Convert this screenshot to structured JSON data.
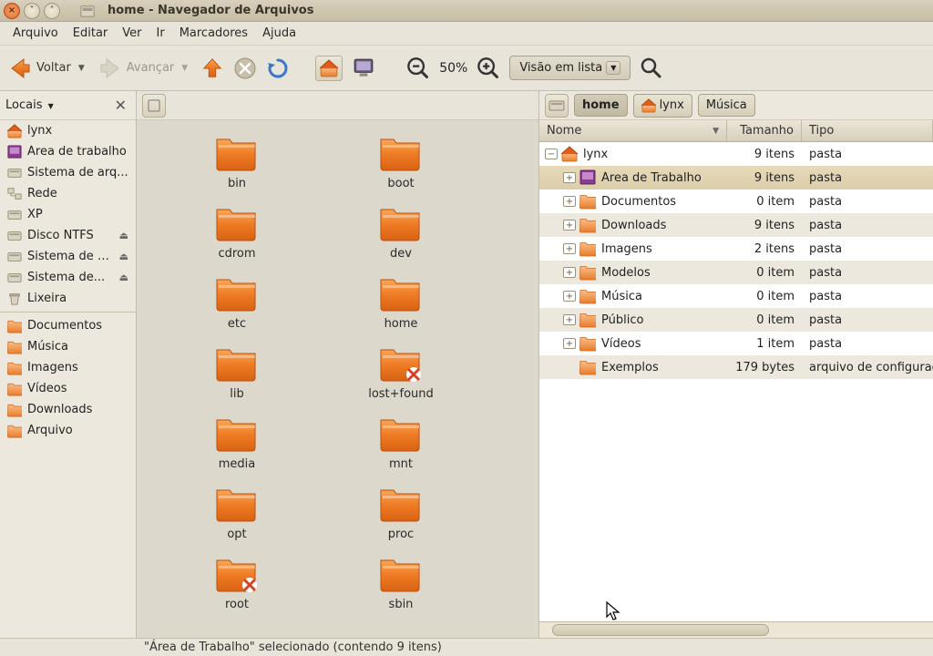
{
  "window": {
    "title": "home - Navegador de Arquivos"
  },
  "menu": {
    "a": "Arquivo",
    "b": "Editar",
    "c": "Ver",
    "d": "Ir",
    "e": "Marcadores",
    "f": "Ajuda"
  },
  "toolbar": {
    "back": "Voltar",
    "forward": "Avançar",
    "zoom_level": "50%",
    "view_mode": "Visão em lista"
  },
  "sidebar": {
    "header": "Locais",
    "items": [
      {
        "label": "lynx",
        "icon": "home"
      },
      {
        "label": "Área de trabalho",
        "icon": "desktop"
      },
      {
        "label": "Sistema de arq...",
        "icon": "disk"
      },
      {
        "label": "Rede",
        "icon": "network"
      },
      {
        "label": "XP",
        "icon": "disk"
      },
      {
        "label": "Disco NTFS",
        "icon": "disk",
        "eject": true
      },
      {
        "label": "Sistema de arq...",
        "icon": "disk",
        "eject": true
      },
      {
        "label": "Sistema de...",
        "icon": "disk",
        "eject": true
      },
      {
        "label": "Lixeira",
        "icon": "trash"
      }
    ],
    "bookmarks": [
      {
        "label": "Documentos",
        "icon": "folder"
      },
      {
        "label": "Música",
        "icon": "folder"
      },
      {
        "label": "Imagens",
        "icon": "folder"
      },
      {
        "label": "Vídeos",
        "icon": "folder"
      },
      {
        "label": "Downloads",
        "icon": "folder"
      },
      {
        "label": "Arquivo",
        "icon": "folder"
      }
    ]
  },
  "icon_view": {
    "items": [
      {
        "name": "bin"
      },
      {
        "name": "boot"
      },
      {
        "name": "cdrom"
      },
      {
        "name": "dev"
      },
      {
        "name": "etc"
      },
      {
        "name": "home"
      },
      {
        "name": "lib"
      },
      {
        "name": "lost+found",
        "locked": true
      },
      {
        "name": "media"
      },
      {
        "name": "mnt"
      },
      {
        "name": "opt"
      },
      {
        "name": "proc"
      },
      {
        "name": "root",
        "locked": true
      },
      {
        "name": "sbin"
      }
    ]
  },
  "pathbar": {
    "a": "home",
    "b": "lynx",
    "c": "Música"
  },
  "tree": {
    "col_name": "Nome",
    "col_size": "Tamanho",
    "col_type": "Tipo",
    "rows": [
      {
        "indent": 0,
        "expander": "-",
        "icon": "home",
        "name": "lynx",
        "size": "9 itens",
        "type": "pasta",
        "selected": false
      },
      {
        "indent": 1,
        "expander": "+",
        "icon": "desktop",
        "name": "Área de Trabalho",
        "size": "9 itens",
        "type": "pasta",
        "selected": true
      },
      {
        "indent": 1,
        "expander": "+",
        "icon": "folder",
        "name": "Documentos",
        "size": "0 item",
        "type": "pasta",
        "selected": false
      },
      {
        "indent": 1,
        "expander": "+",
        "icon": "folder",
        "name": "Downloads",
        "size": "9 itens",
        "type": "pasta",
        "selected": false
      },
      {
        "indent": 1,
        "expander": "+",
        "icon": "folder",
        "name": "Imagens",
        "size": "2 itens",
        "type": "pasta",
        "selected": false
      },
      {
        "indent": 1,
        "expander": "+",
        "icon": "folder",
        "name": "Modelos",
        "size": "0 item",
        "type": "pasta",
        "selected": false
      },
      {
        "indent": 1,
        "expander": "+",
        "icon": "folder",
        "name": "Música",
        "size": "0 item",
        "type": "pasta",
        "selected": false
      },
      {
        "indent": 1,
        "expander": "+",
        "icon": "folder",
        "name": "Público",
        "size": "0 item",
        "type": "pasta",
        "selected": false
      },
      {
        "indent": 1,
        "expander": "+",
        "icon": "folder",
        "name": "Vídeos",
        "size": "1 item",
        "type": "pasta",
        "selected": false
      },
      {
        "indent": 1,
        "expander": "",
        "icon": "folder",
        "name": "Exemplos",
        "size": "179 bytes",
        "type": "arquivo de configuração",
        "selected": false
      }
    ]
  },
  "status": {
    "msg": "\"Área de Trabalho\" selecionado (contendo 9 itens)"
  }
}
